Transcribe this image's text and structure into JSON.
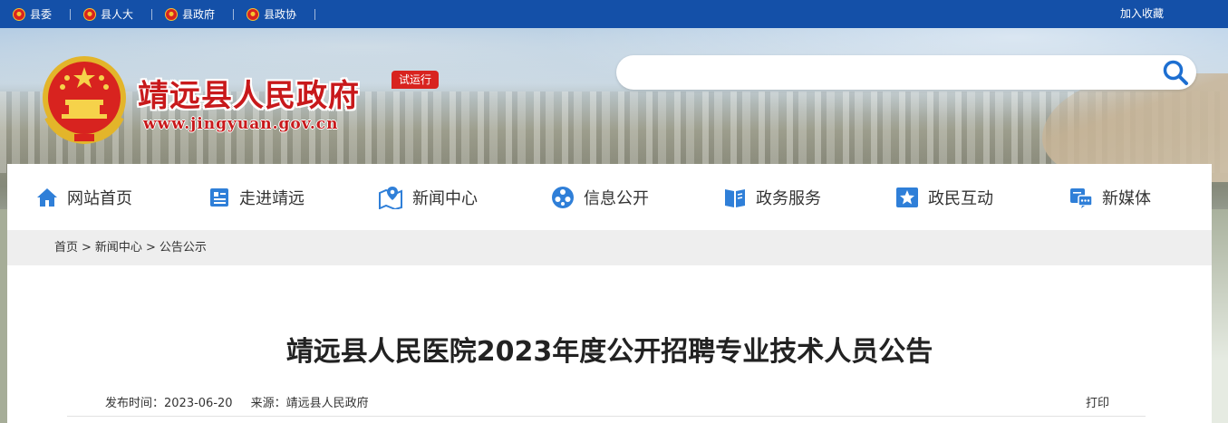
{
  "topbar": {
    "links": [
      {
        "label": "县委"
      },
      {
        "label": "县人大"
      },
      {
        "label": "县政府"
      },
      {
        "label": "县政协"
      }
    ],
    "favorite_label": "加入收藏"
  },
  "header": {
    "site_title": "靖远县人民政府",
    "site_url": "www.jingyuan.gov.cn",
    "badge": "试运行",
    "search_placeholder": ""
  },
  "nav": {
    "items": [
      {
        "label": "网站首页",
        "icon": "home-icon"
      },
      {
        "label": "走进靖远",
        "icon": "document-icon"
      },
      {
        "label": "新闻中心",
        "icon": "map-pin-icon"
      },
      {
        "label": "信息公开",
        "icon": "circle-dots-icon"
      },
      {
        "label": "政务服务",
        "icon": "book-icon"
      },
      {
        "label": "政民互动",
        "icon": "star-icon"
      },
      {
        "label": "新媒体",
        "icon": "media-icon"
      }
    ]
  },
  "breadcrumb": {
    "items": [
      "首页",
      "新闻中心",
      "公告公示"
    ],
    "separator": ">"
  },
  "article": {
    "title": "靖远县人民医院2023年度公开招聘专业技术人员公告",
    "publish_label": "发布时间：",
    "publish_date": "2023-06-20",
    "source_label": "来源：",
    "source": "靖远县人民政府",
    "print_label": "打印"
  },
  "colors": {
    "topbar": "#1450a8",
    "nav_icon": "#2f7fd8",
    "brand_red": "#c8191b"
  }
}
